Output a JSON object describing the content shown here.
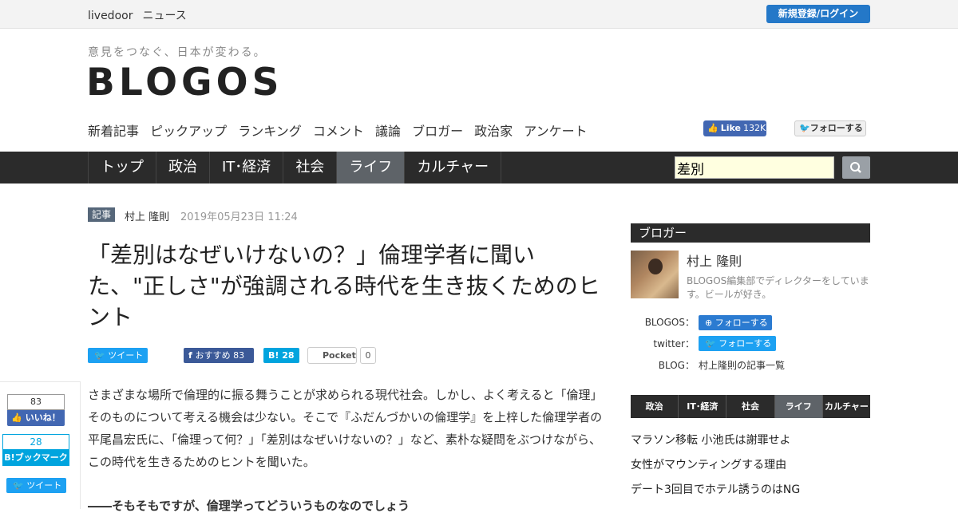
{
  "topbar": {
    "brand": [
      "livedoor",
      "ニュース"
    ],
    "login_label": "新規登録/ログイン"
  },
  "header": {
    "tagline": "意見をつなぐ、日本が変わる。",
    "logo": "BLOGOS",
    "subnav": [
      "新着記事",
      "ピックアップ",
      "ランキング",
      "コメント",
      "議論",
      "ブロガー",
      "政治家",
      "アンケート"
    ],
    "fb_like_label": "Like",
    "fb_like_count": "132K",
    "twitter_follow_label": "フォローする"
  },
  "mainnav": {
    "items": [
      "トップ",
      "政治",
      "IT･経済",
      "社会",
      "ライフ",
      "カルチャー"
    ],
    "active": "ライフ",
    "search_value": "差別"
  },
  "article": {
    "tag": "記事",
    "author": "村上 隆則",
    "date": "2019年05月23日 11:24",
    "title": "「差別はなぜいけないの？」倫理学者に聞いた、\"正しさ\"が強調される時代を生き抜くためのヒント",
    "share": {
      "tweet_label": "ツイート",
      "fb_label": "おすすめ",
      "fb_count": "83",
      "hatena_label": "B!",
      "hatena_count": "28",
      "pocket_label": "Pocket",
      "pocket_count": "0"
    },
    "body": "さまざまな場所で倫理的に振る舞うことが求められる現代社会。しかし、よく考えると「倫理」そのものについて考える機会は少ない。そこで『ふだんづかいの倫理学』を上梓した倫理学者の平尾昌宏氏に、「倫理って何？」「差別はなぜいけないの？」など、素朴な疑問をぶつけながら、この時代を生きるためのヒントを聞いた。",
    "body_next": "――そもそもですが、倫理学ってどういうものなのでしょう"
  },
  "float_share": {
    "fb_count": "83",
    "fb_label": "いいね！",
    "hatena_count": "28",
    "hatena_label": "B!ブックマーク",
    "tweet_label": "ツイート"
  },
  "sidebar": {
    "heading": "ブロガー",
    "name": "村上 隆則",
    "bio": "BLOGOS編集部でディレクターをしています。ビールが好き。",
    "blogos_label": "BLOGOS：",
    "twitter_label": "twitter：",
    "blog_label": "BLOG：",
    "follow_label": "フォローする",
    "blog_link": "村上隆則の記事一覧",
    "tabs": [
      "政治",
      "IT･経済",
      "社会",
      "ライフ",
      "カルチャー"
    ],
    "active_tab": "ライフ",
    "ranking": [
      "マラソン移転 小池氏は謝罪せよ",
      "女性がマウンティングする理由",
      "デート3回目でホテル誘うのはNG"
    ]
  },
  "colors": {
    "accent": "#2478c8",
    "nav_bg": "#2b2b2b",
    "active_tab": "#5e6368",
    "twitter": "#1da1f2",
    "facebook": "#3b5998",
    "hatena": "#00a4de"
  }
}
